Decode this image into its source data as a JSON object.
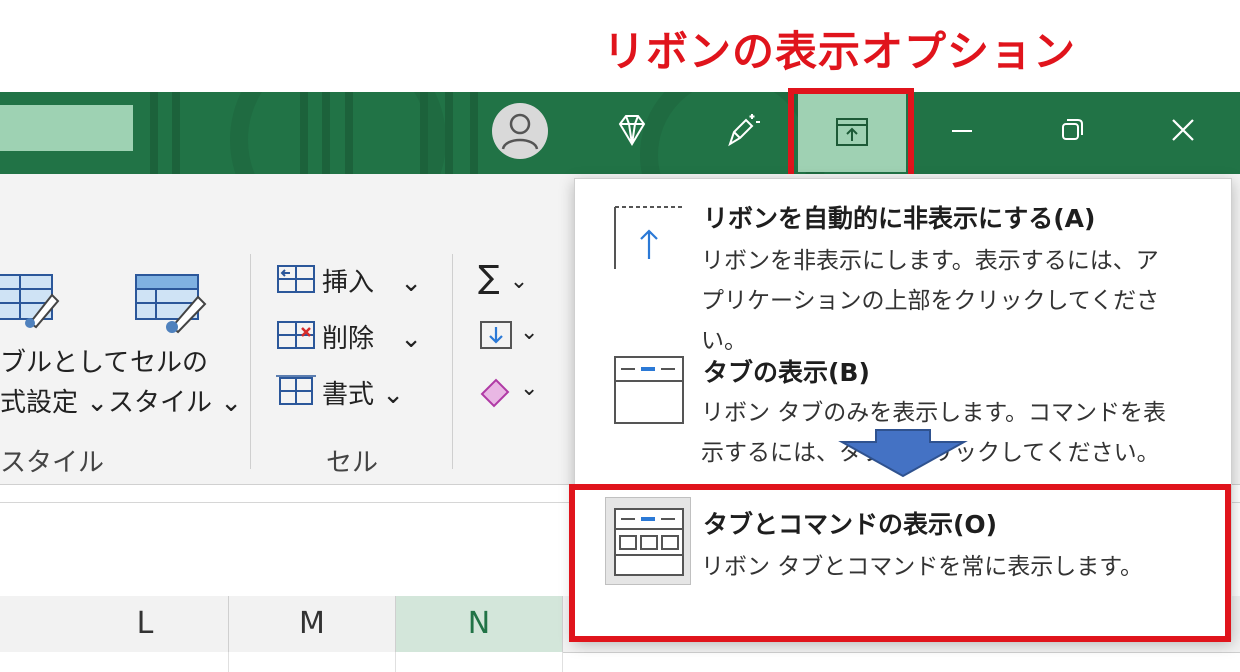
{
  "annotation": {
    "title": "リボンの表示オプション"
  },
  "titlebar": {
    "icons": [
      "avatar-icon",
      "diamond-icon",
      "pen-sparkle-icon",
      "ribbon-display-options-icon",
      "minimize-icon",
      "restore-icon",
      "close-icon"
    ]
  },
  "ribbon": {
    "styles_group": {
      "format_as_table_line1": "ブルとして",
      "format_as_table_line2": "式設定",
      "cell_styles_line1": "セルの",
      "cell_styles_line2": "スタイル",
      "group_label": "スタイル"
    },
    "cells_group": {
      "insert": "挿入",
      "delete": "削除",
      "format": "書式",
      "group_label": "セル"
    }
  },
  "columns": [
    "L",
    "M",
    "N"
  ],
  "menu": {
    "items": [
      {
        "title": "リボンを自動的に非表示にする(A)",
        "desc_line1": "リボンを非表示にします。表示するには、ア",
        "desc_line2": "プリケーションの上部をクリックしてください。"
      },
      {
        "title": "タブの表示(B)",
        "desc_line1": "リボン タブのみを表示します。コマンドを表",
        "desc_line2": "示するには、タブをクリックしてください。"
      },
      {
        "title": "タブとコマンドの表示(O)",
        "desc_line1": "リボン タブとコマンドを常に表示します。"
      }
    ]
  },
  "colors": {
    "titlebar": "#217346",
    "highlight": "#e0141c",
    "arrow": "#4472c4"
  }
}
